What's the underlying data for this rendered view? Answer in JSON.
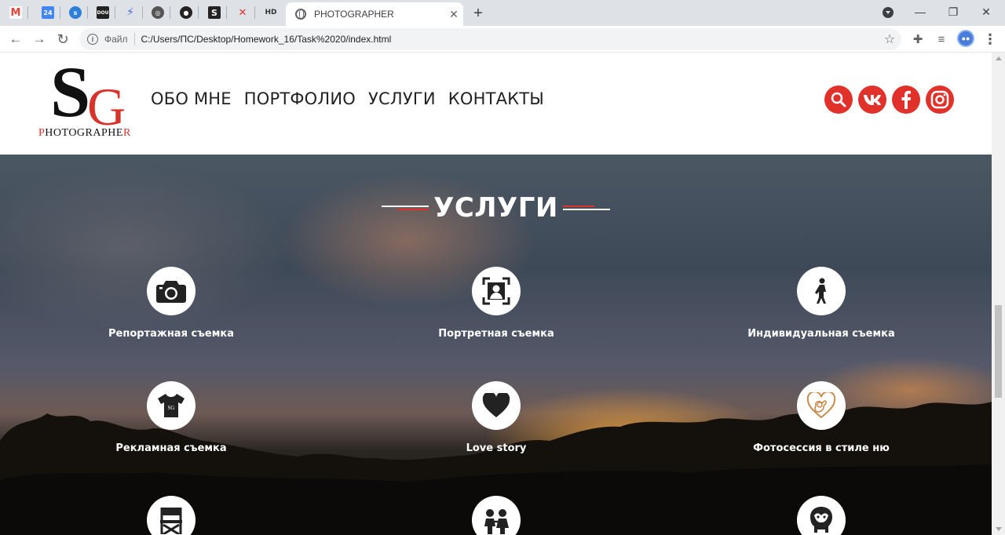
{
  "browser": {
    "pinned_tabs": [
      {
        "icon": "gmail-icon",
        "text": "M",
        "color": "#ea4335"
      },
      {
        "icon": "calendar-24-icon",
        "text": "24",
        "color": "#4285f4"
      },
      {
        "icon": "stackshare-icon",
        "text": "",
        "color": "#2d7fd9"
      },
      {
        "icon": "dou-icon",
        "text": "DOU",
        "color": "#222222"
      },
      {
        "icon": "bolt-icon",
        "text": "",
        "color": "#3f6fd8"
      },
      {
        "icon": "webstorm-icon",
        "text": "",
        "color": "#555555"
      },
      {
        "icon": "github-icon",
        "text": "",
        "color": "#222222"
      },
      {
        "icon": "s-app-icon",
        "text": "S",
        "color": "#222222"
      },
      {
        "icon": "figure-icon",
        "text": "",
        "color": "#e0322b"
      },
      {
        "icon": "hd-icon",
        "text": "HD",
        "color": "#333333"
      }
    ],
    "active_tab": {
      "title": "PHOTOGRAPHER"
    },
    "address": {
      "scheme": "Файл",
      "url": "C:/Users/ПС/Desktop/Homework_16/Task%2020/index.html"
    }
  },
  "header": {
    "logo": {
      "big": "S",
      "small": "G",
      "caption_first": "P",
      "caption_mid": "HOTOGRAPHE",
      "caption_last": "R"
    },
    "nav": [
      "ОБО МНЕ",
      "ПОРТФОЛИО",
      "УСЛУГИ",
      "КОНТАКТЫ"
    ],
    "social": [
      "search-icon",
      "vk-icon",
      "facebook-icon",
      "instagram-icon"
    ],
    "accent": "#e0322b"
  },
  "services": {
    "title": "УСЛУГИ",
    "items": [
      {
        "label": "Репортажная съемка",
        "icon": "camera-icon"
      },
      {
        "label": "Портретная съемка",
        "icon": "portrait-icon"
      },
      {
        "label": "Индивидуальная съемка",
        "icon": "walking-person-icon"
      },
      {
        "label": "Рекламная съемка",
        "icon": "tshirt-icon"
      },
      {
        "label": "Love story",
        "icon": "heart-icon"
      },
      {
        "label": "Фотосессия в стиле ню",
        "icon": "heart-hand-icon"
      },
      {
        "label": "",
        "icon": "director-chair-icon"
      },
      {
        "label": "",
        "icon": "kids-icon"
      },
      {
        "label": "",
        "icon": "face-icon"
      }
    ]
  }
}
